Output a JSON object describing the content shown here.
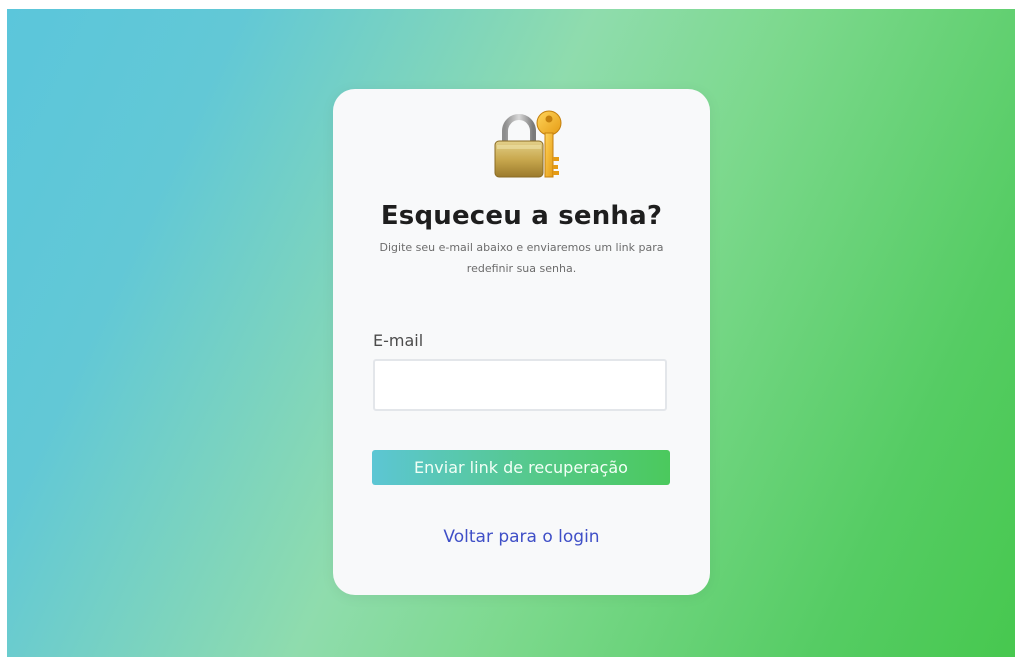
{
  "page": {
    "icon": "lock-with-key-icon",
    "title": "Esqueceu a senha?",
    "subtitle": "Digite seu e-mail abaixo e enviaremos um link para redefinir sua senha."
  },
  "form": {
    "email_label": "E-mail",
    "email_value": "",
    "email_placeholder": "",
    "submit_label": "Enviar link de recuperação"
  },
  "footer": {
    "back_link": "Voltar para o login"
  },
  "colors": {
    "background_gradient_start": "#5bc6db",
    "background_gradient_end": "#47c84f",
    "card": "#f8f9fa",
    "title": "#1e1e1e",
    "link": "#3f4fc7",
    "button_gradient_start": "#5cc6d4",
    "button_gradient_end": "#4bc95d"
  }
}
